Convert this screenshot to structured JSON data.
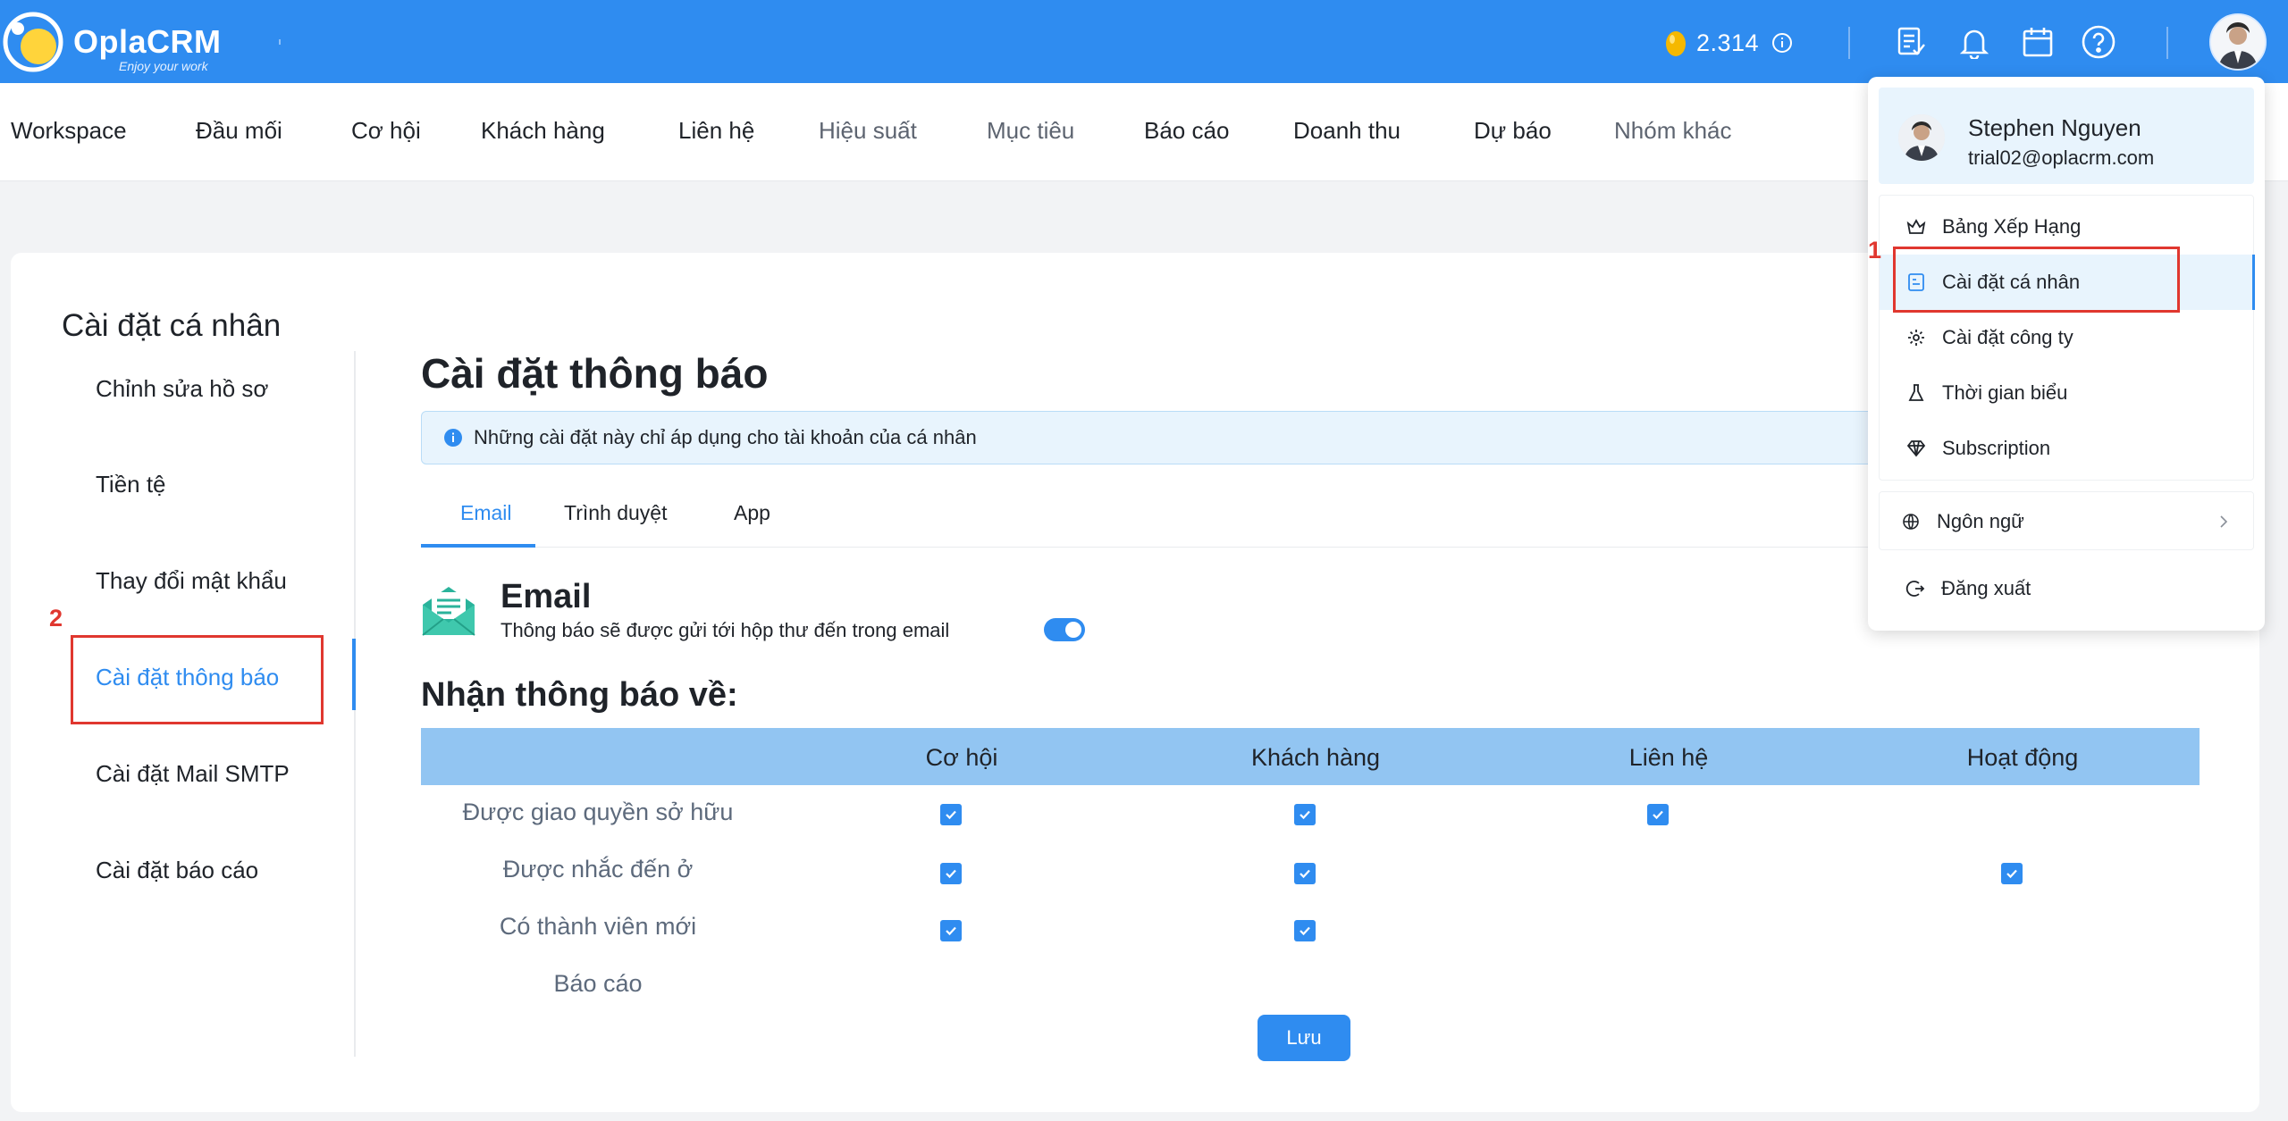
{
  "brand": {
    "name": "OplaCRM",
    "tagline": "Enjoy your work"
  },
  "header": {
    "coins": "2.314"
  },
  "nav": [
    {
      "label": "Workspace",
      "muted": false
    },
    {
      "label": "Đầu mối",
      "muted": false
    },
    {
      "label": "Cơ hội",
      "muted": false
    },
    {
      "label": "Khách hàng",
      "muted": false
    },
    {
      "label": "Liên hệ",
      "muted": false
    },
    {
      "label": "Hiệu suất",
      "muted": true
    },
    {
      "label": "Mục tiêu",
      "muted": true
    },
    {
      "label": "Báo cáo",
      "muted": false
    },
    {
      "label": "Doanh thu",
      "muted": false
    },
    {
      "label": "Dự báo",
      "muted": false
    },
    {
      "label": "Nhóm khác",
      "muted": true
    }
  ],
  "sidebar": {
    "title": "Cài đặt cá nhân",
    "items": [
      {
        "label": "Chỉnh sửa hồ sơ"
      },
      {
        "label": "Tiền tệ"
      },
      {
        "label": "Thay đổi mật khẩu"
      },
      {
        "label": "Cài đặt thông báo",
        "active": true
      },
      {
        "label": "Cài đặt Mail SMTP"
      },
      {
        "label": "Cài đặt báo cáo"
      }
    ]
  },
  "main": {
    "title": "Cài đặt thông báo",
    "notice": "Những cài đặt này chỉ áp dụng cho tài khoản của cá nhân",
    "tabs": [
      {
        "label": "Email",
        "active": true
      },
      {
        "label": "Trình duyệt"
      },
      {
        "label": "App"
      }
    ],
    "email_section": {
      "title": "Email",
      "description": "Thông báo sẽ được gửi tới hộp thư đến trong email",
      "enabled": true
    },
    "subtitle": "Nhận thông báo về:",
    "matrix": {
      "columns": [
        "Cơ hội",
        "Khách hàng",
        "Liên hệ",
        "Hoạt động"
      ],
      "rows": [
        {
          "label": "Được giao quyền sở hữu",
          "checks": [
            true,
            true,
            true,
            false
          ]
        },
        {
          "label": "Được nhắc đến ở",
          "checks": [
            true,
            true,
            false,
            true
          ]
        },
        {
          "label": "Có thành viên mới",
          "checks": [
            true,
            true,
            false,
            false
          ]
        },
        {
          "label": "Báo cáo",
          "checks": [
            false,
            false,
            false,
            false
          ]
        }
      ]
    },
    "save_label": "Lưu"
  },
  "dropdown": {
    "user_name": "Stephen Nguyen",
    "user_email": "trial02@oplacrm.com",
    "items": [
      {
        "label": "Bảng Xếp Hạng",
        "icon": "crown-icon"
      },
      {
        "label": "Cài đặt cá nhân",
        "icon": "profile-card-icon",
        "highlighted": true
      },
      {
        "label": "Cài đặt công ty",
        "icon": "gear-icon"
      },
      {
        "label": "Thời gian biểu",
        "icon": "flask-icon"
      },
      {
        "label": "Subscription",
        "icon": "diamond-icon"
      }
    ],
    "language_label": "Ngôn ngữ",
    "logout_label": "Đăng xuất"
  },
  "annotations": [
    "1",
    "2"
  ],
  "colors": {
    "primary": "#2f8cf0",
    "annotation": "#e0372f",
    "table_header": "#92c5f2"
  }
}
